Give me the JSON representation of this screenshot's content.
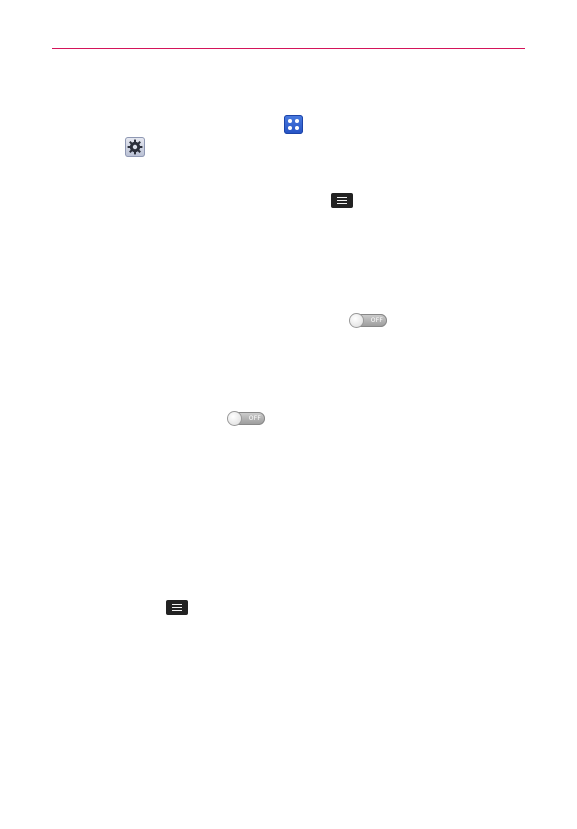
{
  "header": {
    "rule_color": "#d4145a"
  },
  "icons": {
    "apps": "apps-icon",
    "settings": "settings-icon",
    "menu_top": "menu-key-icon",
    "toggle_1": "toggle-icon",
    "toggle_2": "toggle-icon",
    "menu_bottom": "menu-key-icon"
  },
  "toggles": {
    "first_label": "OFF",
    "second_label": "OFF"
  }
}
